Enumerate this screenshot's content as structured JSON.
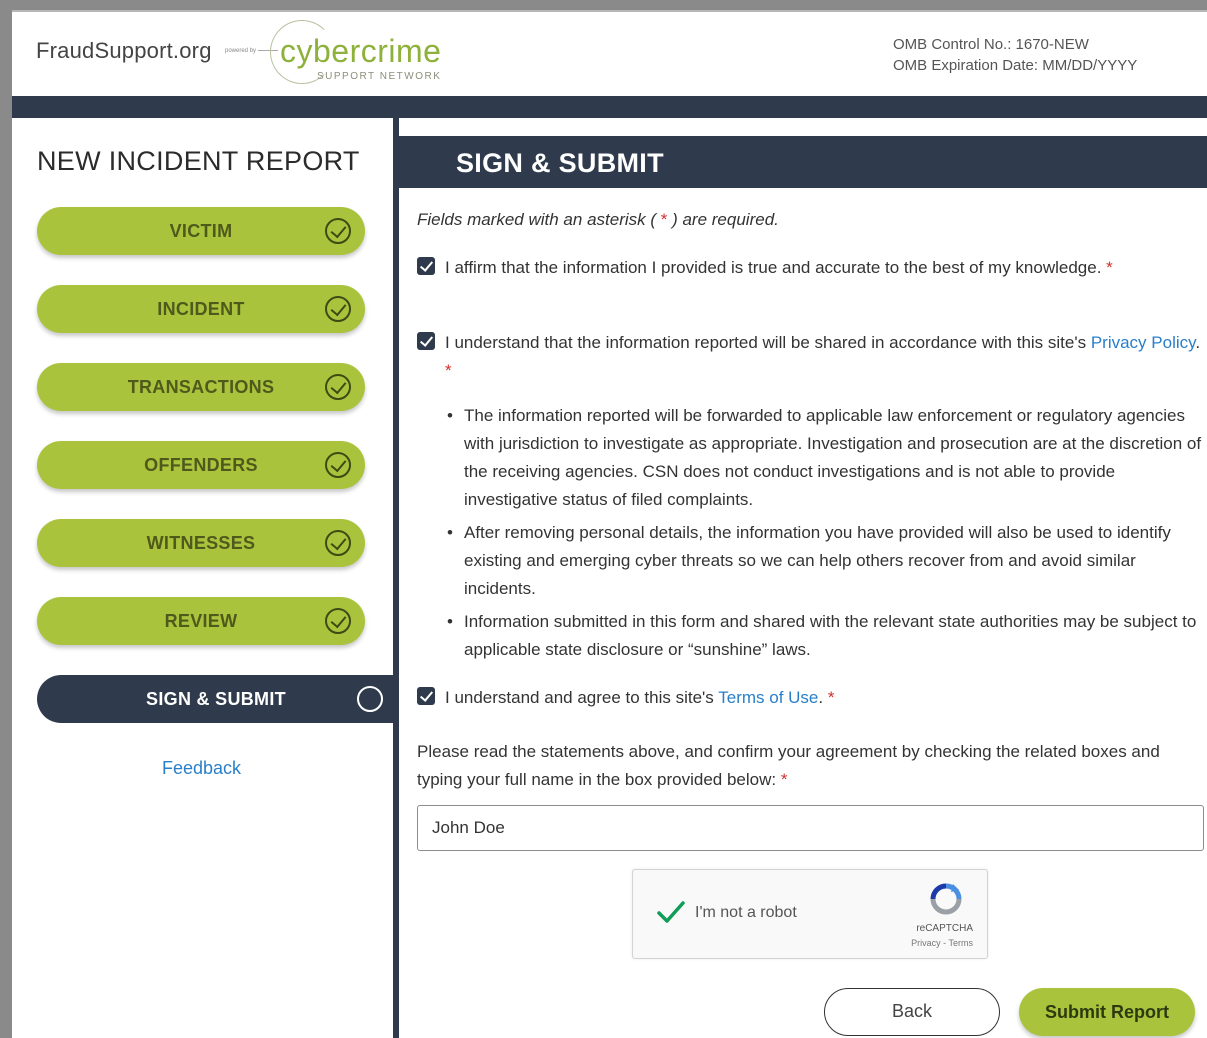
{
  "header": {
    "brand": "FraudSupport.org",
    "powered_by": "powered by",
    "partner_name": "cybercrime",
    "partner_sub": "SUPPORT NETWORK",
    "omb_control": "OMB Control No.: 1670-NEW",
    "omb_expiration": "OMB Expiration Date: MM/DD/YYYY"
  },
  "sidebar": {
    "title": "NEW INCIDENT REPORT",
    "steps": [
      {
        "label": "VICTIM",
        "status": "complete"
      },
      {
        "label": "INCIDENT",
        "status": "complete"
      },
      {
        "label": "TRANSACTIONS",
        "status": "complete"
      },
      {
        "label": "OFFENDERS",
        "status": "complete"
      },
      {
        "label": "WITNESSES",
        "status": "complete"
      },
      {
        "label": "REVIEW",
        "status": "complete"
      },
      {
        "label": "SIGN & SUBMIT",
        "status": "current"
      }
    ],
    "feedback": "Feedback"
  },
  "main": {
    "title": "SIGN & SUBMIT",
    "required_note_pre": "Fields marked with an asterisk (",
    "required_star": " * ",
    "required_note_post": ") are required.",
    "affirm": {
      "text": "I affirm that the information I provided is true and accurate to the best of my knowledge.",
      "checked": true
    },
    "privacy": {
      "text": "I understand that the information reported will be shared in accordance with this site's ",
      "link": "Privacy Policy",
      "checked": true
    },
    "bullets": [
      "The information reported will be forwarded to applicable law enforcement or regulatory agencies with jurisdiction to investigate as appropriate. Investigation and prosecution are at the discretion of the receiving agencies. CSN does not conduct investigations and is not able to provide investigative status of filed complaints.",
      "After removing personal details, the information you have provided will also be used to identify existing and emerging cyber threats so we can help others recover from and avoid similar incidents.",
      "Information submitted in this form and shared with the relevant state authorities may be subject to applicable state disclosure or “sunshine” laws."
    ],
    "terms": {
      "text": "I understand and agree to this site's ",
      "link": "Terms of Use",
      "checked": true
    },
    "prompt": "Please read the statements above, and confirm your agreement by checking the related boxes and typing your full name in the box provided below:",
    "name_value": "John Doe",
    "captcha": {
      "label": "I'm not a robot",
      "brand": "reCAPTCHA",
      "sub": "Privacy - Terms",
      "checked": true
    },
    "back_label": "Back",
    "submit_label": "Submit Report"
  },
  "colors": {
    "navy": "#2f3b4c",
    "green": "#a9c43c",
    "link": "#2a7fc9",
    "required": "#d32f2f"
  }
}
